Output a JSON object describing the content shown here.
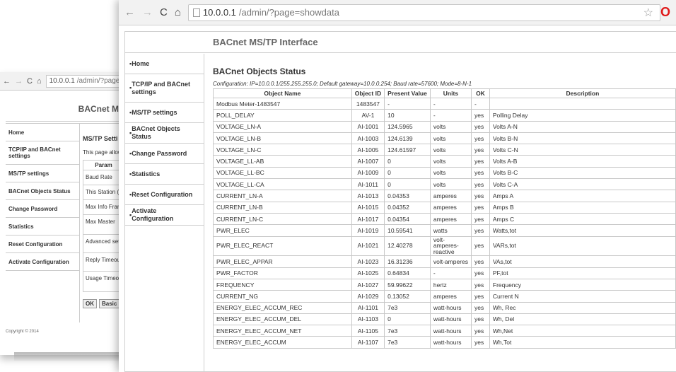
{
  "back_window": {
    "address": {
      "host": "10.0.0.1",
      "path": "/admin/?page="
    },
    "app_title": "BACnet MS",
    "nav": [
      "Home",
      "TCP/IP and BACnet settings",
      "MS/TP settings",
      "BACnet Objects Status",
      "Change Password",
      "Statistics",
      "Reset Configuration",
      "Activate Configuration"
    ],
    "heading": "MS/TP Setti",
    "description": "This page allow",
    "param_header": "Param",
    "params": [
      "Baud Rate",
      "This Station (M",
      "Max Info Frame",
      "Max Master"
    ],
    "advanced": "Advanced settin",
    "timeouts": [
      "Reply Timeout",
      "Usage Timeout"
    ],
    "buttons": [
      "OK",
      "Basic"
    ],
    "copyright": "Copyright © 2014"
  },
  "browser": {
    "back_icon": "back-arrow-icon",
    "forward_icon": "forward-arrow-icon",
    "reload_icon": "reload-icon",
    "home_icon": "home-icon",
    "url_host": "10.0.0.1",
    "url_path": "/admin/?page=showdata",
    "bookmark_icon": "star-icon",
    "browser_logo_icon": "opera-logo-icon"
  },
  "app": {
    "title": "BACnet MS/TP Interface",
    "nav": [
      {
        "label": "Home"
      },
      {
        "label": "TCP/IP and BACnet settings"
      },
      {
        "label": "MS/TP settings"
      },
      {
        "label": "BACnet Objects Status"
      },
      {
        "label": "Change Password"
      },
      {
        "label": "Statistics"
      },
      {
        "label": "Reset Configuration"
      },
      {
        "label": "Activate Configuration"
      }
    ],
    "heading": "BACnet Objects Status",
    "configuration": "Configuration: IP=10.0.0.1/255.255.255.0; Default gateway=10.0.0.254; Baud rate=57600; Mode=8-N-1",
    "columns": [
      "Object Name",
      "Object ID",
      "Present Value",
      "Units",
      "OK",
      "Description"
    ],
    "rows": [
      [
        "Modbus Meter-1483547",
        "1483547",
        "-",
        "-",
        "-",
        ""
      ],
      [
        "POLL_DELAY",
        "AV-1",
        "10",
        "-",
        "yes",
        "Polling Delay"
      ],
      [
        "VOLTAGE_LN-A",
        "AI-1001",
        "124.5965",
        "volts",
        "yes",
        "Volts A-N"
      ],
      [
        "VOLTAGE_LN-B",
        "AI-1003",
        "124.6139",
        "volts",
        "yes",
        "Volts B-N"
      ],
      [
        "VOLTAGE_LN-C",
        "AI-1005",
        "124.61597",
        "volts",
        "yes",
        "Volts C-N"
      ],
      [
        "VOLTAGE_LL-AB",
        "AI-1007",
        "0",
        "volts",
        "yes",
        "Volts A-B"
      ],
      [
        "VOLTAGE_LL-BC",
        "AI-1009",
        "0",
        "volts",
        "yes",
        "Volts B-C"
      ],
      [
        "VOLTAGE_LL-CA",
        "AI-1011",
        "0",
        "volts",
        "yes",
        "Volts C-A"
      ],
      [
        "CURRENT_LN-A",
        "AI-1013",
        "0.04353",
        "amperes",
        "yes",
        "Amps A"
      ],
      [
        "CURRENT_LN-B",
        "AI-1015",
        "0.04352",
        "amperes",
        "yes",
        "Amps B"
      ],
      [
        "CURRENT_LN-C",
        "AI-1017",
        "0.04354",
        "amperes",
        "yes",
        "Amps C"
      ],
      [
        "PWR_ELEC",
        "AI-1019",
        "10.59541",
        "watts",
        "yes",
        "Watts,tot"
      ],
      [
        "PWR_ELEC_REACT",
        "AI-1021",
        "12.40278",
        "volt-amperes-reactive",
        "yes",
        "VARs,tot"
      ],
      [
        "PWR_ELEC_APPAR",
        "AI-1023",
        "16.31236",
        "volt-amperes",
        "yes",
        "VAs,tot"
      ],
      [
        "PWR_FACTOR",
        "AI-1025",
        "0.64834",
        "-",
        "yes",
        "PF,tot"
      ],
      [
        "FREQUENCY",
        "AI-1027",
        "59.99622",
        "hertz",
        "yes",
        "Frequency"
      ],
      [
        "CURRENT_NG",
        "AI-1029",
        "0.13052",
        "amperes",
        "yes",
        "Current N"
      ],
      [
        "ENERGY_ELEC_ACCUM_REC",
        "AI-1101",
        "7e3",
        "watt-hours",
        "yes",
        "Wh, Rec"
      ],
      [
        "ENERGY_ELEC_ACCUM_DEL",
        "AI-1103",
        "0",
        "watt-hours",
        "yes",
        "Wh, Del"
      ],
      [
        "ENERGY_ELEC_ACCUM_NET",
        "AI-1105",
        "7e3",
        "watt-hours",
        "yes",
        "Wh,Net"
      ],
      [
        "ENERGY_ELEC_ACCUM",
        "AI-1107",
        "7e3",
        "watt-hours",
        "yes",
        "Wh,Tot"
      ]
    ]
  }
}
